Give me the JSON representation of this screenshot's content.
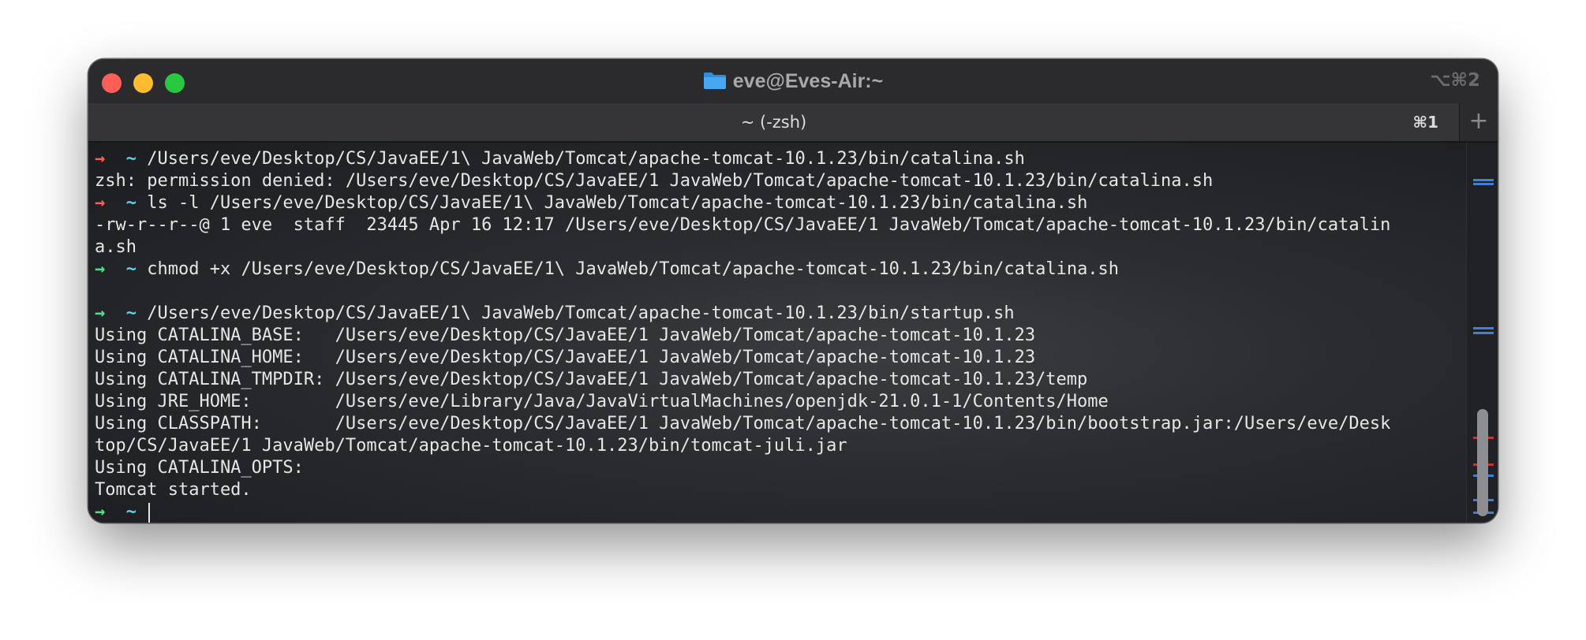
{
  "window": {
    "title": "eve@Eves-Air:~",
    "shortcut": "⌥⌘2"
  },
  "tabs": [
    {
      "label": "~ (-zsh)",
      "shortcut": "⌘1"
    }
  ],
  "new_tab_label": "+",
  "prompt": {
    "arrow": "→",
    "tilde": "~"
  },
  "terminal": {
    "lines": [
      {
        "kind": "prompt",
        "status": "error",
        "text": "/Users/eve/Desktop/CS/JavaEE/1\\ JavaWeb/Tomcat/apache-tomcat-10.1.23/bin/catalina.sh"
      },
      {
        "kind": "output",
        "text": "zsh: permission denied: /Users/eve/Desktop/CS/JavaEE/1 JavaWeb/Tomcat/apache-tomcat-10.1.23/bin/catalina.sh"
      },
      {
        "kind": "prompt",
        "status": "error",
        "text": "ls -l /Users/eve/Desktop/CS/JavaEE/1\\ JavaWeb/Tomcat/apache-tomcat-10.1.23/bin/catalina.sh"
      },
      {
        "kind": "output",
        "text": "-rw-r--r--@ 1 eve  staff  23445 Apr 16 12:17 /Users/eve/Desktop/CS/JavaEE/1 JavaWeb/Tomcat/apache-tomcat-10.1.23/bin/catalin"
      },
      {
        "kind": "output",
        "text": "a.sh"
      },
      {
        "kind": "prompt",
        "status": "ok",
        "text": "chmod +x /Users/eve/Desktop/CS/JavaEE/1\\ JavaWeb/Tomcat/apache-tomcat-10.1.23/bin/catalina.sh"
      },
      {
        "kind": "output",
        "text": ""
      },
      {
        "kind": "prompt",
        "status": "ok",
        "text": "/Users/eve/Desktop/CS/JavaEE/1\\ JavaWeb/Tomcat/apache-tomcat-10.1.23/bin/startup.sh"
      },
      {
        "kind": "output",
        "text": "Using CATALINA_BASE:   /Users/eve/Desktop/CS/JavaEE/1 JavaWeb/Tomcat/apache-tomcat-10.1.23"
      },
      {
        "kind": "output",
        "text": "Using CATALINA_HOME:   /Users/eve/Desktop/CS/JavaEE/1 JavaWeb/Tomcat/apache-tomcat-10.1.23"
      },
      {
        "kind": "output",
        "text": "Using CATALINA_TMPDIR: /Users/eve/Desktop/CS/JavaEE/1 JavaWeb/Tomcat/apache-tomcat-10.1.23/temp"
      },
      {
        "kind": "output",
        "text": "Using JRE_HOME:        /Users/eve/Library/Java/JavaVirtualMachines/openjdk-21.0.1-1/Contents/Home"
      },
      {
        "kind": "output",
        "text": "Using CLASSPATH:       /Users/eve/Desktop/CS/JavaEE/1 JavaWeb/Tomcat/apache-tomcat-10.1.23/bin/bootstrap.jar:/Users/eve/Desk"
      },
      {
        "kind": "output",
        "text": "top/CS/JavaEE/1 JavaWeb/Tomcat/apache-tomcat-10.1.23/bin/tomcat-juli.jar"
      },
      {
        "kind": "output",
        "text": "Using CATALINA_OPTS:"
      },
      {
        "kind": "output",
        "text": "Tomcat started."
      },
      {
        "kind": "prompt",
        "status": "ok",
        "text": "",
        "cursor": true
      }
    ]
  },
  "colors": {
    "prompt_error": "#ff5c57",
    "prompt_ok": "#4fe08a",
    "tilde": "#5ed5f0",
    "text": "#e6e6e6",
    "scroll_mark_blue": "#3f7fd6",
    "scroll_mark_red": "#c4343c"
  }
}
